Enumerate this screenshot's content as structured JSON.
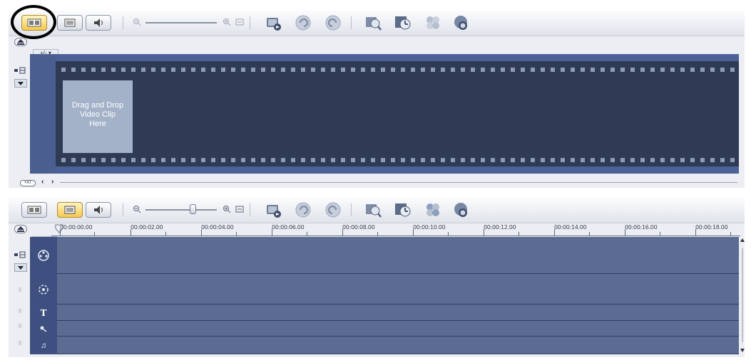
{
  "top_panel": {
    "dropzone": {
      "line1": "Drag and Drop",
      "line2": "Video Clip",
      "line3": "Here"
    },
    "plus_minus": "+/- ▾",
    "nav_arrows": "‹ ›",
    "fit_label": "+AT"
  },
  "bottom_panel": {
    "plus_minus": "+/- ▾",
    "ruler": {
      "labels": [
        "00:00:00.00",
        "00:00:02.00",
        "00:00:04.00",
        "00:00:06.00",
        "00:00:08.00",
        "00:00:10.00",
        "00:00:12.00",
        "00:00:14.00",
        "00:00:16.00",
        "00:00:18.00"
      ]
    },
    "tracks": [
      {
        "name": "video-track",
        "icon": "film-reel-icon"
      },
      {
        "name": "overlay-track",
        "icon": "overlay-reel-icon"
      },
      {
        "name": "title-track",
        "icon": "title-icon",
        "glyph": "T"
      },
      {
        "name": "voice-track",
        "icon": "microphone-icon"
      },
      {
        "name": "music-track",
        "icon": "music-note-icon",
        "glyph": "♫"
      }
    ]
  },
  "colors": {
    "active_button": "#f5c94f",
    "timeline_bg": "#5b6b92",
    "film_bg": "#2f3a55",
    "highlight_circle": "#000000"
  },
  "state": {
    "top_active_view": "storyboard-view",
    "bottom_active_view": "timeline-view",
    "top_zoom_fraction": 0.0,
    "bottom_zoom_fraction": 0.65
  }
}
